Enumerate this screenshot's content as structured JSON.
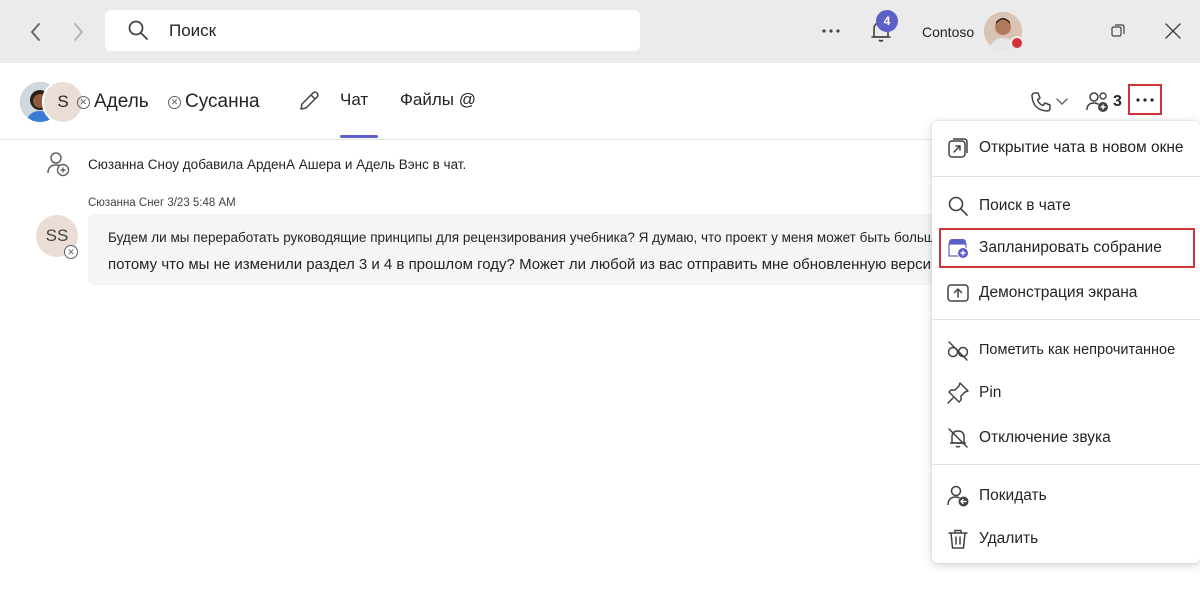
{
  "topbar": {
    "search_placeholder": "Поиск",
    "notification_count": "4",
    "org_name": "Contoso"
  },
  "chat_header": {
    "group_avatar_letter": "S",
    "participants": [
      "Адель",
      "Сусанна"
    ],
    "tabs": [
      "Чат",
      "Файлы @"
    ],
    "active_tab": "Чат",
    "people_count": "3"
  },
  "chat": {
    "system_message": "Сюзанна Сноу добавила АрденА Ашера и Адель Вэнс в чат.",
    "message": {
      "author_time": "Сюзанна Снег 3/23 5:48 AM",
      "avatar_initials": "SS",
      "line1": "Будем ли мы переработать руководящие принципы для рецензирования учебника? Я думаю, что проект у меня может быть больше,",
      "line2": "потому что мы не изменили раздел 3 и 4 в прошлом году? Может ли любой из вас отправить мне обновленную версию?"
    }
  },
  "menu": {
    "items": [
      {
        "label": "Открытие чата в новом окне",
        "icon": "open-in-new-window-icon"
      },
      {
        "label": "Поиск в чате",
        "icon": "search-icon"
      },
      {
        "label": "Запланировать собрание",
        "icon": "calendar-add-icon"
      },
      {
        "label": "Демонстрация экрана",
        "icon": "share-screen-icon"
      },
      {
        "label": "Пометить как непрочитанное",
        "icon": "mark-unread-icon"
      },
      {
        "label": "Pin",
        "icon": "pin-icon"
      },
      {
        "label": "Отключение звука",
        "icon": "mute-bell-icon"
      },
      {
        "label": "Покидать",
        "icon": "leave-icon"
      },
      {
        "label": "Удалить",
        "icon": "delete-icon"
      }
    ]
  },
  "colors": {
    "accent": "#5b5fc7",
    "highlight_red": "#d13438",
    "topbar_bg": "#ebebeb"
  }
}
